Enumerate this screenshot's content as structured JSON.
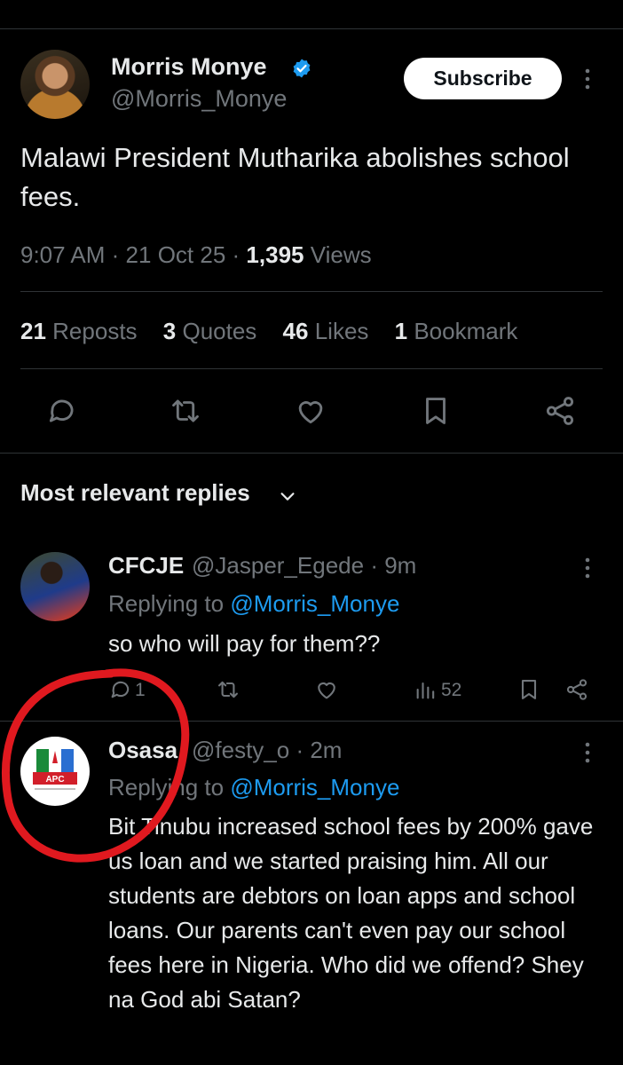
{
  "tweet": {
    "author_name": "Morris Monye",
    "author_handle": "@Morris_Monye",
    "subscribe_label": "Subscribe",
    "text": "Malawi President Mutharika abolishes school fees.",
    "time": "9:07 AM",
    "sep1": "·",
    "date": "21 Oct 25",
    "sep2": "·",
    "views_count": "1,395",
    "views_label": "Views",
    "stats": {
      "reposts_count": "21",
      "reposts_label": "Reposts",
      "quotes_count": "3",
      "quotes_label": "Quotes",
      "likes_count": "46",
      "likes_label": "Likes",
      "bookmarks_count": "1",
      "bookmarks_label": "Bookmark"
    },
    "actions": [
      "reply-icon",
      "repost-icon",
      "like-icon",
      "bookmark-icon",
      "share-icon"
    ]
  },
  "replies_heading": "Most relevant replies",
  "replies": [
    {
      "name": "CFCJE",
      "handle": "@Jasper_Egede",
      "time": "· 9m",
      "replying_prefix": "Replying to",
      "replying_to": "@Morris_Monye",
      "text": "so who will pay for them??",
      "reply_count": "1",
      "views_count": "52"
    },
    {
      "name": "Osasa",
      "handle": "@festy_o",
      "time": "· 2m",
      "replying_prefix": "Replying to",
      "replying_to": "@Morris_Monye",
      "text": "Bit Tinubu increased school fees by 200% gave us loan and we started praising him. All our students are debtors on loan apps and school loans. Our parents can't even pay our school fees here in Nigeria. Who did we offend? Shey na God abi Satan?",
      "avatar_logo_text": "APC"
    }
  ],
  "colors": {
    "background": "#000000",
    "text_primary": "#e7e9ea",
    "text_secondary": "#71767b",
    "link": "#1d9bf0",
    "verified": "#1d9bf0",
    "annotation_red": "#e0191f"
  }
}
